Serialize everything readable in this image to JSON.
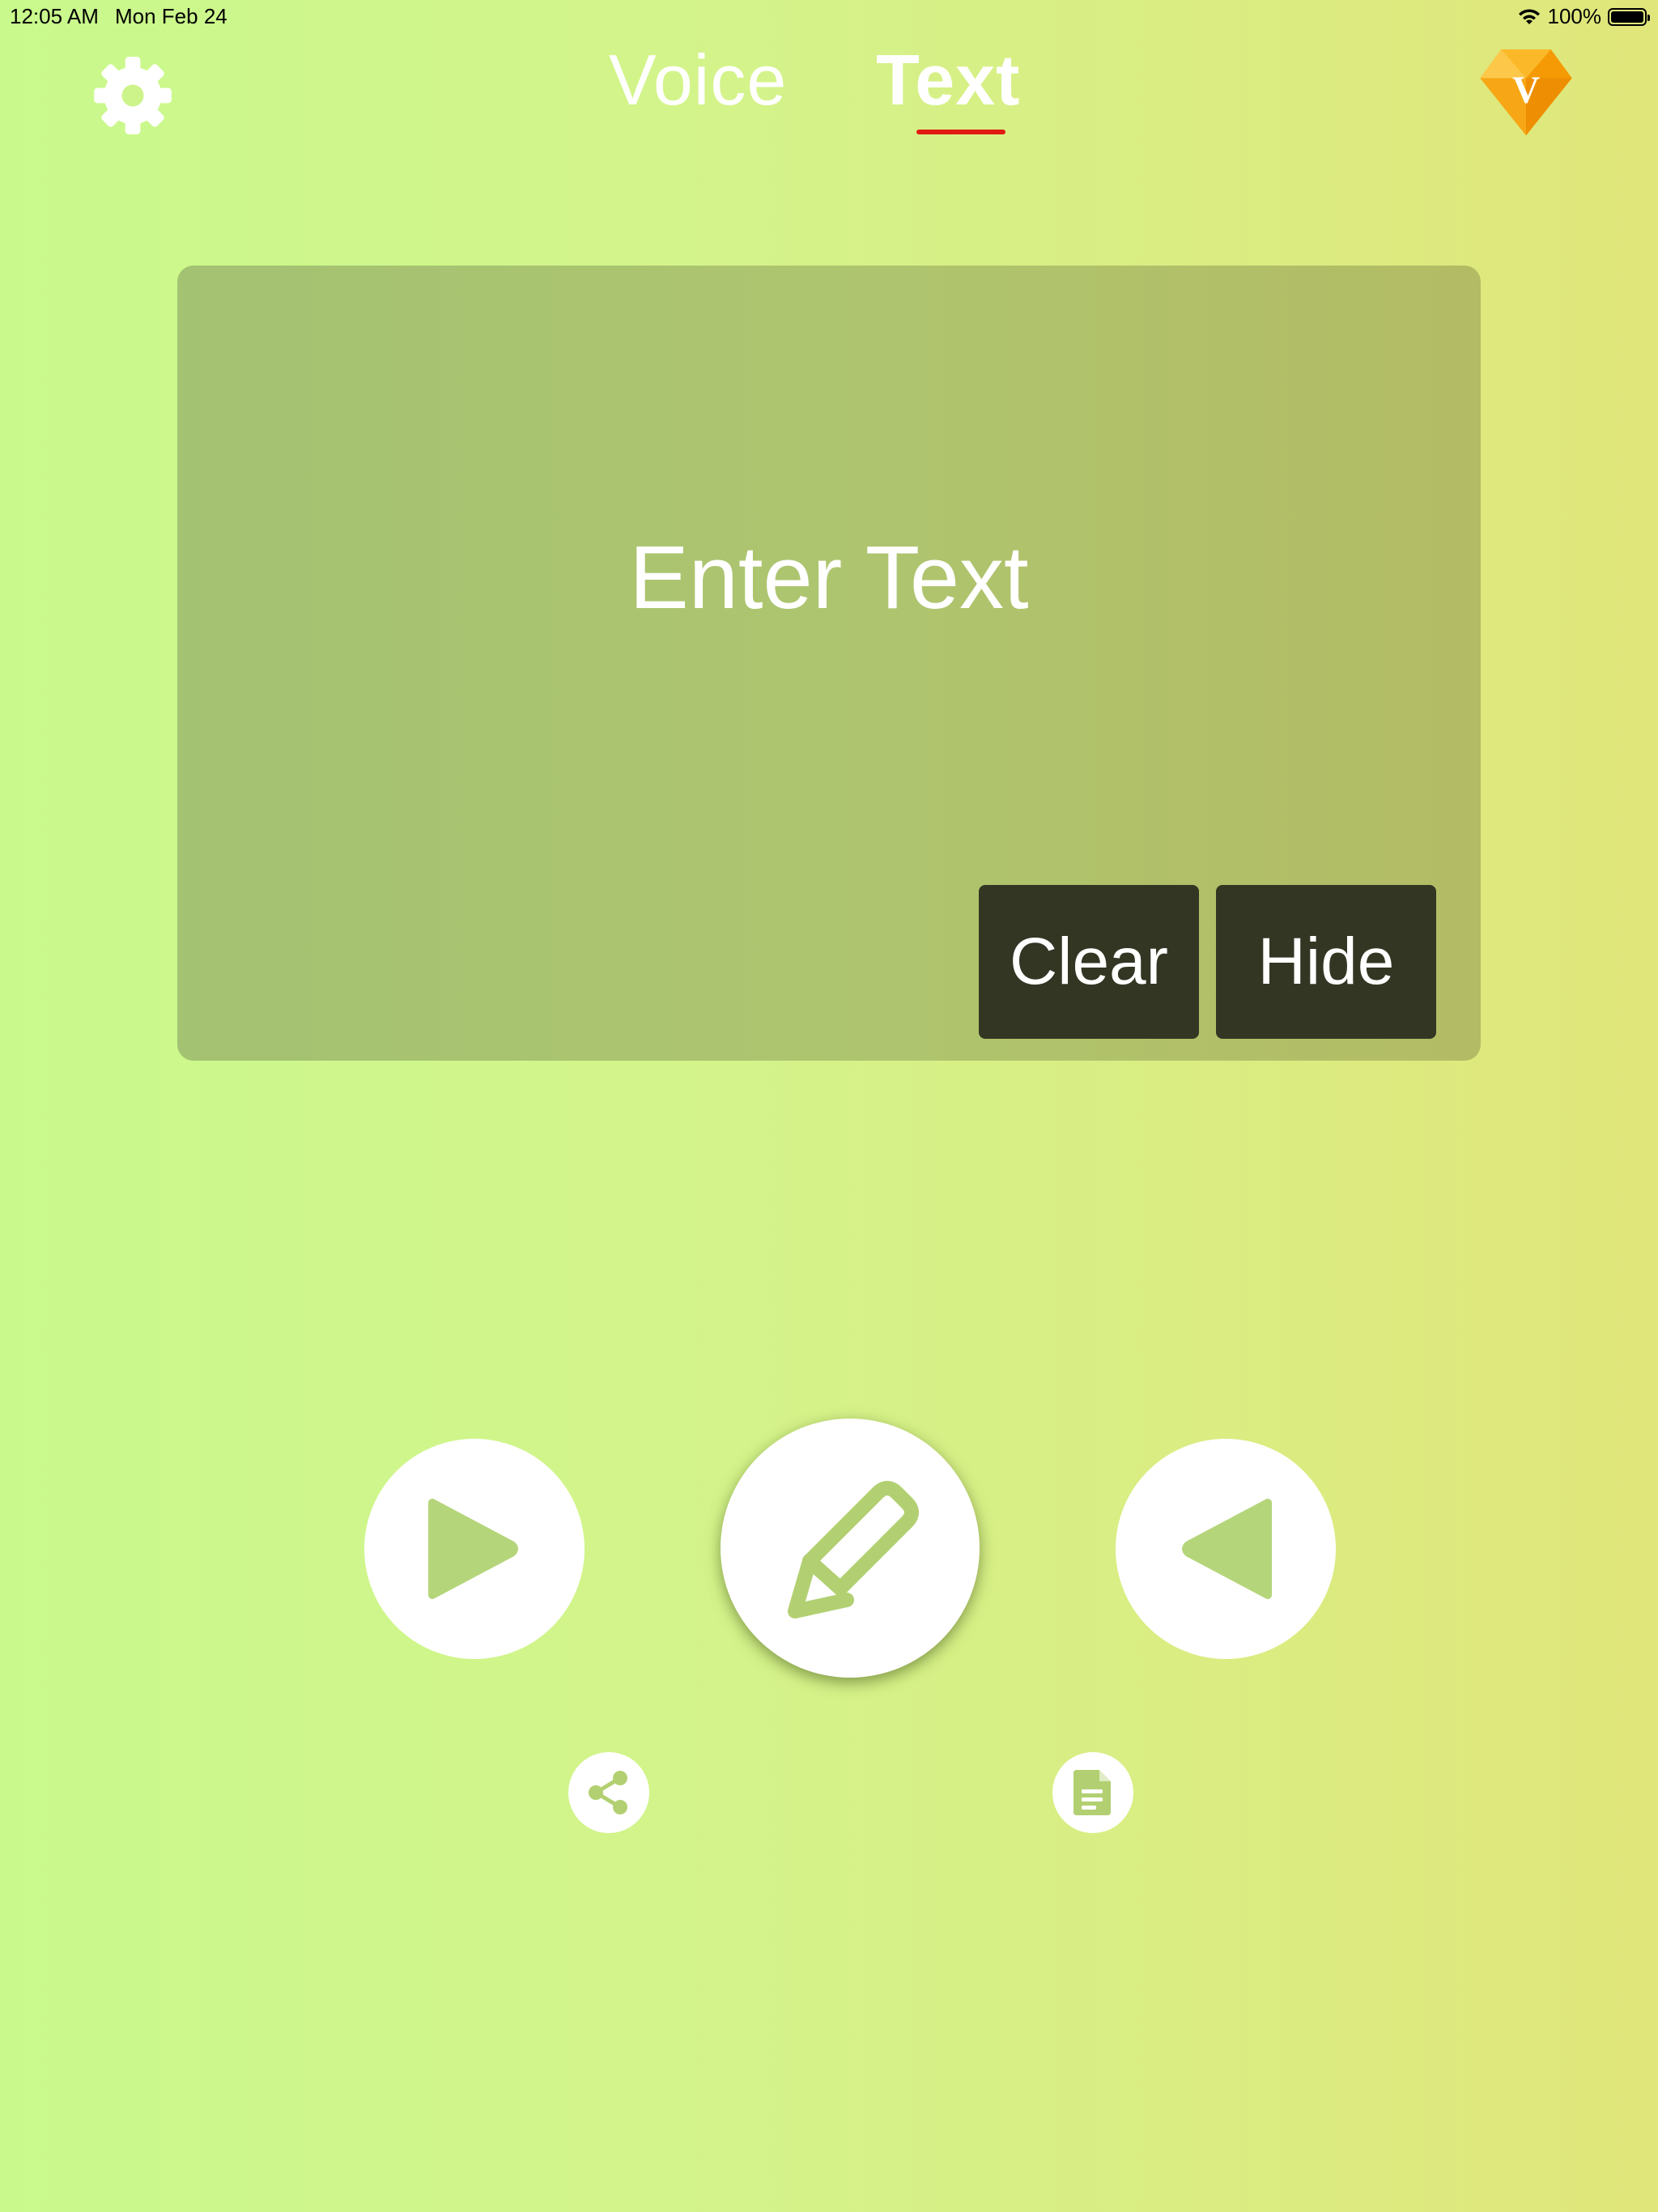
{
  "status_bar": {
    "time": "12:05 AM",
    "date": "Mon Feb 24",
    "battery": "100%",
    "battery_level": 1.0
  },
  "nav": {
    "tabs": [
      {
        "label": "Voice",
        "selected": false
      },
      {
        "label": "Text",
        "selected": true
      }
    ],
    "settings_icon": "gear-icon",
    "premium_icon": "diamond-icon",
    "premium_letter": "V"
  },
  "text_panel": {
    "placeholder": "Enter Text",
    "clear_label": "Clear",
    "hide_label": "Hide"
  },
  "controls": {
    "play_icon": "play-icon",
    "edit_icon": "pencil-icon",
    "back_icon": "reverse-play-icon",
    "share_icon": "share-icon",
    "document_icon": "document-icon"
  },
  "colors": {
    "accent_underline": "#e01b12",
    "icon_green": "#b2d071",
    "button_dark": "#333623",
    "gem_orange": "#f7a30b"
  }
}
